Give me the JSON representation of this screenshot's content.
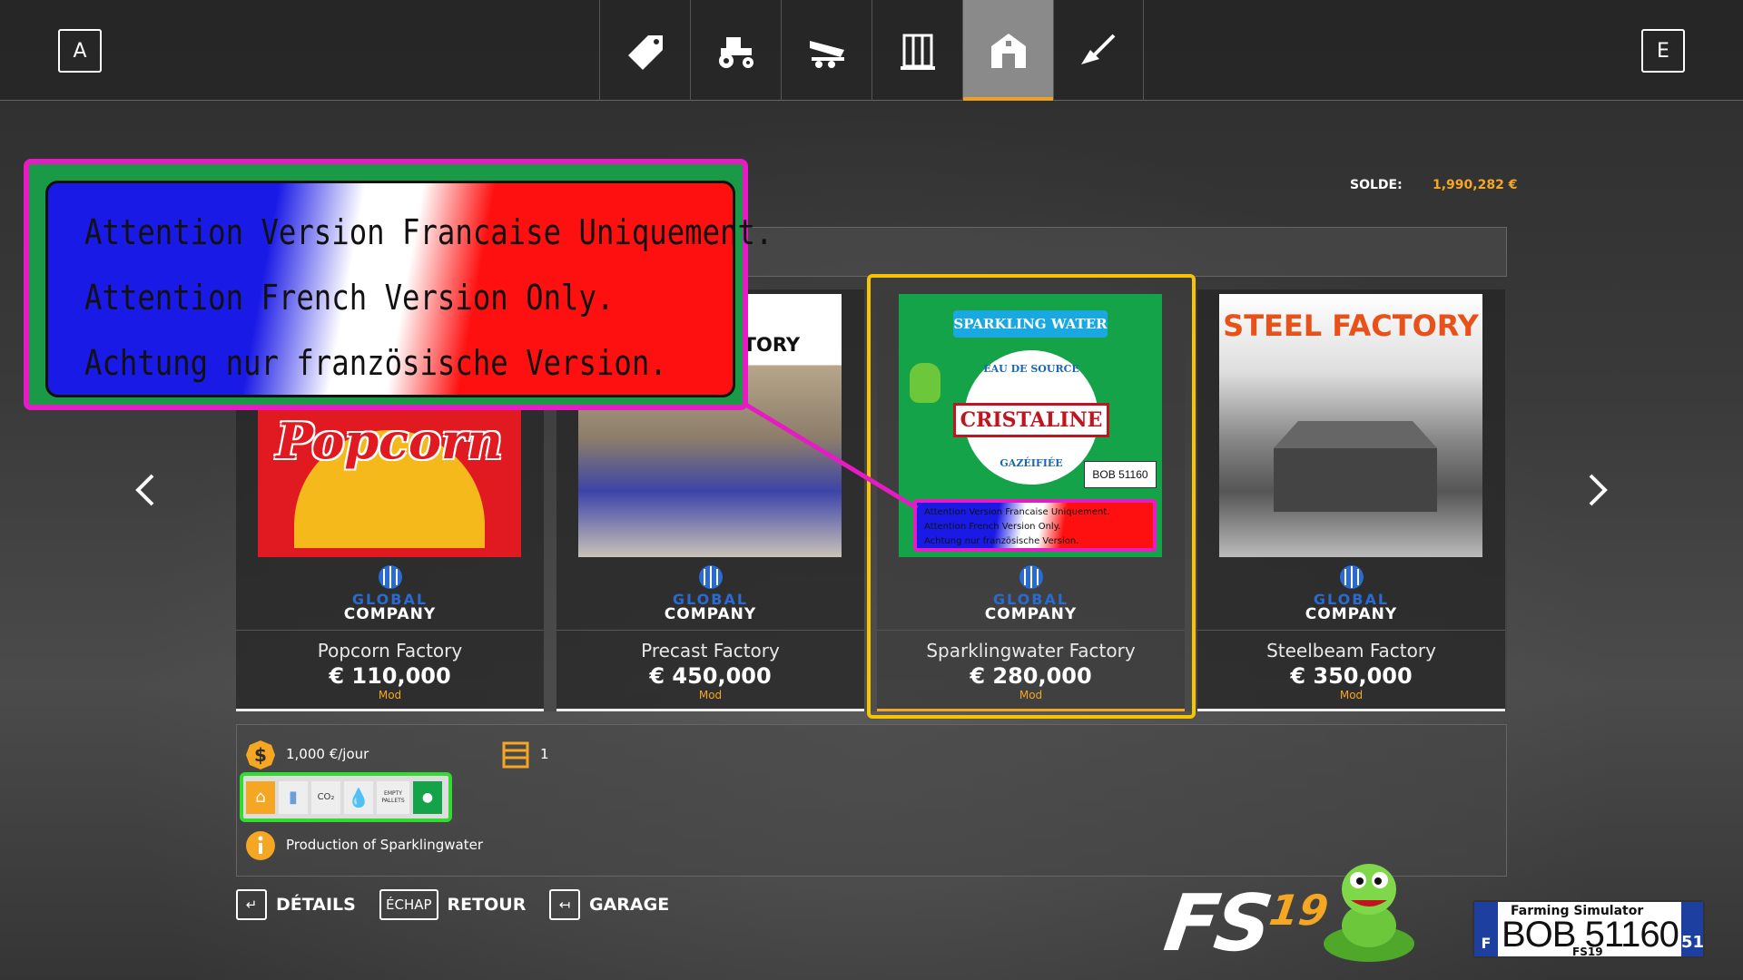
{
  "topbar": {
    "left_key": "A",
    "right_key": "E",
    "tabs": [
      {
        "icon": "price-tag-icon",
        "active": false
      },
      {
        "icon": "tractor-icon",
        "active": false
      },
      {
        "icon": "trailer-icon",
        "active": false
      },
      {
        "icon": "silo-icon",
        "active": false
      },
      {
        "icon": "barn-icon",
        "active": true
      },
      {
        "icon": "shovel-icon",
        "active": false
      }
    ]
  },
  "balance": {
    "label": "SOLDE:",
    "value": "1,990,282 €"
  },
  "overlay": {
    "lines": [
      "Attention Version Francaise Uniquement.",
      "Attention French Version Only.",
      "Achtung nur französische Version."
    ]
  },
  "cards": [
    {
      "name": "Popcorn Factory",
      "price": "€ 110,000",
      "tag": "Mod",
      "thumb_title": "Popcorn",
      "brand1": "GLOBAL",
      "brand2": "COMPANY"
    },
    {
      "name": "Precast Factory",
      "price": "€ 450,000",
      "tag": "Mod",
      "thumb_title": "ACTORY",
      "brand1": "GLOBAL",
      "brand2": "COMPANY"
    },
    {
      "name": "Sparklingwater Factory",
      "price": "€ 280,000",
      "tag": "Mod",
      "thumb_title": "CRISTALINE",
      "thumb_banner": "SPARKLING WATER",
      "thumb_sub1": "EAU DE SOURCE",
      "thumb_sub2": "GAZÉIFIÉE",
      "brand1": "GLOBAL",
      "brand2": "COMPANY",
      "selected": true
    },
    {
      "name": "Steelbeam Factory",
      "price": "€ 350,000",
      "tag": "Mod",
      "thumb_title": "STEEL FACTORY",
      "brand1": "GLOBAL",
      "brand2": "COMPANY"
    }
  ],
  "details": {
    "cost_per_day": "1,000 €/jour",
    "count": "1",
    "description": "Production of Sparklingwater",
    "ingredient_labels": [
      "CO₂",
      "EMPTY PALLETS"
    ]
  },
  "bottom_buttons": [
    {
      "key": "↵",
      "label": "DÉTAILS"
    },
    {
      "key": "ÉCHAP",
      "label": "RETOUR"
    },
    {
      "key": "↤",
      "label": "GARAGE"
    }
  ],
  "branding": {
    "fs": "FS",
    "fs_num": "19",
    "plate_top": "Farming Simulator",
    "plate_num": "BOB 51160",
    "plate_sub": "FS19",
    "plate_country": "F",
    "plate_dep": "51"
  },
  "colors": {
    "accent": "#f5a623",
    "selection": "#f6c400",
    "highlight_green": "#2fdc2f",
    "highlight_magenta": "#e51bc4"
  }
}
